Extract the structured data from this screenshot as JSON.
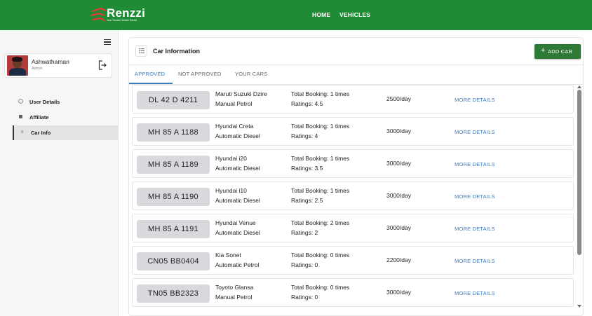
{
  "app": {
    "brand": "Renzzi",
    "tagline": "Your Trusted Vehicle Rental",
    "brand_color": "#1f8b35",
    "accent_color": "#3b7bc2"
  },
  "nav": {
    "home": "HOME",
    "vehicles": "VEHICLES"
  },
  "sidebar": {
    "menu_icon": "hamburger-icon",
    "profile": {
      "name": "Ashwathaman",
      "role": "Admin",
      "logout_icon": "logout-icon"
    },
    "items": [
      {
        "label": "User Details",
        "icon": "user-icon",
        "active": false
      },
      {
        "label": "Affiliate",
        "icon": "building-icon",
        "active": false
      },
      {
        "label": "Car Info",
        "icon": "list-icon",
        "active": true
      }
    ]
  },
  "main": {
    "title": "Car Information",
    "add_button": "ADD CAR",
    "tabs": [
      {
        "label": "APPROVED",
        "active": true
      },
      {
        "label": "NOT APPROVED",
        "active": false
      },
      {
        "label": "YOUR CARS",
        "active": false
      }
    ],
    "cars": [
      {
        "plate": "DL 42 D 4211",
        "name": "Maruti Suzuki Dzire",
        "type": "Manual Petrol",
        "bookings": "Total Booking: 1 times",
        "ratings": "Ratings: 4.5",
        "price": "2500/day",
        "link": "MORE DETAILS"
      },
      {
        "plate": "MH 85 A 1188",
        "name": "Hyundai Creta",
        "type": "Automatic Diesel",
        "bookings": "Total Booking: 1 times",
        "ratings": "Ratings: 4",
        "price": "3000/day",
        "link": "MORE DETAILS"
      },
      {
        "plate": "MH 85 A 1189",
        "name": "Hyundai i20",
        "type": "Automatic Diesel",
        "bookings": "Total Booking: 1 times",
        "ratings": "Ratings: 3.5",
        "price": "3000/day",
        "link": "MORE DETAILS"
      },
      {
        "plate": "MH 85 A 1190",
        "name": "Hyundai i10",
        "type": "Automatic Diesel",
        "bookings": "Total Booking: 1 times",
        "ratings": "Ratings: 2.5",
        "price": "3000/day",
        "link": "MORE DETAILS"
      },
      {
        "plate": "MH 85 A 1191",
        "name": "Hyundai Venue",
        "type": "Automatic Diesel",
        "bookings": "Total Booking: 2 times",
        "ratings": "Ratings: 2",
        "price": "3000/day",
        "link": "MORE DETAILS"
      },
      {
        "plate": "CN05 BB0404",
        "name": "Kia Sonet",
        "type": "Automatic Petrol",
        "bookings": "Total Booking: 0 times",
        "ratings": "Ratings: 0",
        "price": "2200/day",
        "link": "MORE DETAILS"
      },
      {
        "plate": "TN05 BB2323",
        "name": "Toyoto Glansa",
        "type": "Manual Petrol",
        "bookings": "Total Booking: 0 times",
        "ratings": "Ratings: 0",
        "price": "3000/day",
        "link": "MORE DETAILS"
      }
    ]
  }
}
